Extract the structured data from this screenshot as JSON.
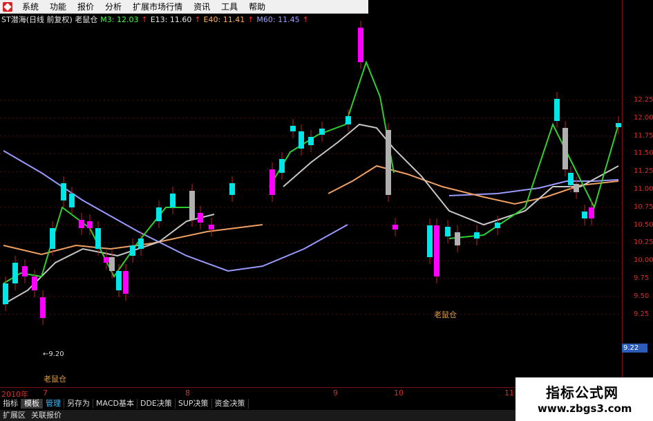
{
  "menu": [
    "系统",
    "功能",
    "报价",
    "分析",
    "扩展市场行情",
    "资讯",
    "工具",
    "帮助"
  ],
  "info": {
    "title": "ST潜海(日线 前复权) 老鼠仓",
    "ma": [
      {
        "label": "M3: 12.03",
        "color": "#40ff40"
      },
      {
        "label": "E13: 11.60",
        "color": "#e8e8e8"
      },
      {
        "label": "E40: 11.41",
        "color": "#ffb060"
      },
      {
        "label": "M60: 11.45",
        "color": "#a0a0ff"
      }
    ],
    "arrow_color": "#ff3030"
  },
  "yaxis": [
    "12.25",
    "12.00",
    "11.75",
    "11.50",
    "11.25",
    "11.00",
    "10.75",
    "10.50",
    "10.25",
    "10.00",
    "9.75",
    "9.50",
    "9.25"
  ],
  "current_price": "9.22",
  "low_marker": "9.20",
  "annotations": [
    "老鼠仓",
    "老鼠仓"
  ],
  "xaxis": [
    "2010年",
    "7",
    "8",
    "9",
    "10",
    "11"
  ],
  "tabs": [
    "指标",
    "模板",
    "管理",
    "另存为",
    "MACD基本",
    "DDE决策",
    "SUP决策",
    "资金决策"
  ],
  "bottom": [
    "扩展区",
    "关联报价"
  ],
  "watermark": {
    "title": "指标公式网",
    "url": "www.zbgs3.com"
  },
  "colors": {
    "up": "#00e5e5",
    "down": "#ff00ff",
    "flat": "#b0b0b0",
    "candle_outline": "#ff3030",
    "grid": "#5a0c0c"
  }
}
